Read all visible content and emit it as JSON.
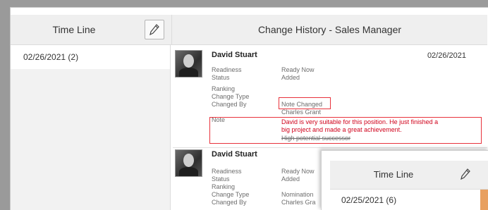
{
  "header": {
    "timeline_title": "Time Line",
    "change_history_title": "Change History - Sales Manager"
  },
  "left_pane": {
    "items": [
      {
        "label": "02/26/2021 (2)"
      }
    ]
  },
  "entries": [
    {
      "name": "David Stuart",
      "date": "02/26/2021",
      "fields": [
        {
          "label": "Readiness",
          "value": "Ready Now"
        },
        {
          "label": "Status",
          "value": "Added"
        },
        {
          "label": "Ranking",
          "value": ""
        },
        {
          "label": "Change Type",
          "value": "Note Changed"
        },
        {
          "label": "Changed By",
          "value": "Charles Grant"
        },
        {
          "label": "Note",
          "value_line1": "David is very suitable for this position. He just finished a",
          "value_line2": "big project and made a great achievement.",
          "value_old": "High potential successor"
        }
      ]
    },
    {
      "name": "David Stuart",
      "fields": [
        {
          "label": "Readiness",
          "value": "Ready Now"
        },
        {
          "label": "Status",
          "value": "Added"
        },
        {
          "label": "Ranking",
          "value": ""
        },
        {
          "label": "Change Type",
          "value": "Nomination"
        },
        {
          "label": "Changed By",
          "value": "Charles Gra"
        }
      ]
    }
  ],
  "popup": {
    "timeline_title": "Time Line",
    "date_item": "02/25/2021 (6)"
  },
  "icons": {
    "edit": "pencil-icon"
  }
}
